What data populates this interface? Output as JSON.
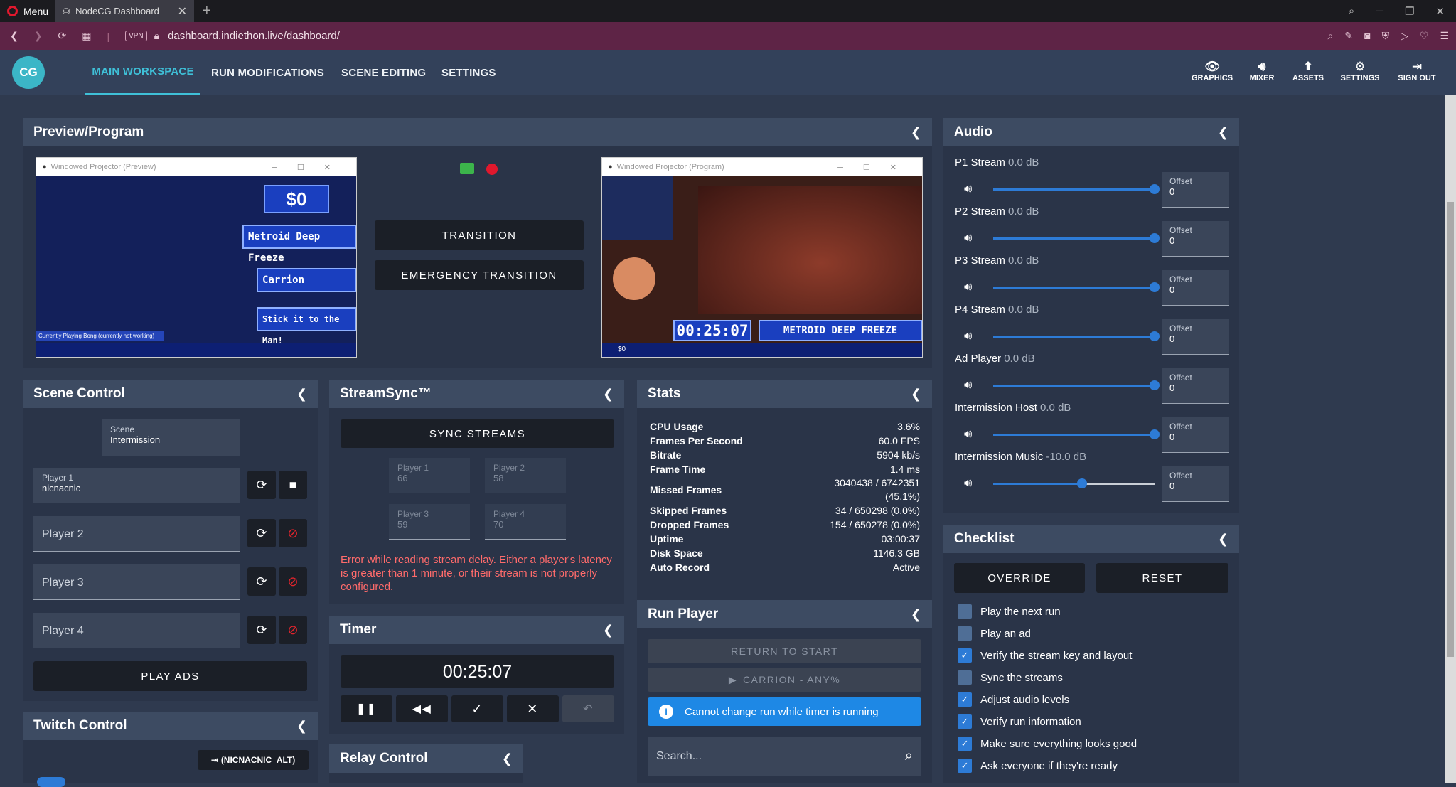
{
  "browser": {
    "menu_label": "Menu",
    "tab_title": "NodeCG Dashboard",
    "url": "dashboard.indiethon.live/dashboard/",
    "vpn": "VPN"
  },
  "app": {
    "logo_text": "CG",
    "nav_tabs": [
      "MAIN WORKSPACE",
      "RUN MODIFICATIONS",
      "SCENE EDITING",
      "SETTINGS"
    ],
    "right_icons": [
      "GRAPHICS",
      "MIXER",
      "ASSETS",
      "SETTINGS",
      "SIGN OUT"
    ]
  },
  "preview": {
    "title": "Preview/Program",
    "preview_window_title": "Windowed Projector (Preview)",
    "program_window_title": "Windowed Projector (Program)",
    "preview_money": "$0",
    "preview_games": [
      "Metroid Deep Freeze",
      "Carrion",
      "Stick it to the Man!"
    ],
    "preview_ticker": "Currently Playing Bong (currently not working)",
    "program_timer": "00:25:07",
    "program_game": "METROID DEEP FREEZE",
    "program_money": "$0",
    "transition_label": "TRANSITION",
    "emergency_label": "EMERGENCY TRANSITION"
  },
  "scene_control": {
    "title": "Scene Control",
    "scene_label": "Scene",
    "scene_value": "Intermission",
    "players": [
      {
        "label": "Player 1",
        "value": "nicnacnic"
      },
      {
        "label": "Player 2",
        "value": ""
      },
      {
        "label": "Player 3",
        "value": ""
      },
      {
        "label": "Player 4",
        "value": ""
      }
    ],
    "play_ads": "PLAY ADS"
  },
  "streamsync": {
    "title": "StreamSync™",
    "sync_label": "SYNC STREAMS",
    "players": [
      {
        "label": "Player 1",
        "value": "66"
      },
      {
        "label": "Player 2",
        "value": "58"
      },
      {
        "label": "Player 3",
        "value": "59"
      },
      {
        "label": "Player 4",
        "value": "70"
      }
    ],
    "error": "Error while reading stream delay. Either a player's latency is greater than 1 minute, or their stream is not properly configured."
  },
  "stats": {
    "title": "Stats",
    "rows": [
      {
        "k": "CPU Usage",
        "v": "3.6%"
      },
      {
        "k": "Frames Per Second",
        "v": "60.0 FPS"
      },
      {
        "k": "Bitrate",
        "v": "5904 kb/s"
      },
      {
        "k": "Frame Time",
        "v": "1.4 ms"
      },
      {
        "k": "Missed Frames",
        "v": "3040438 / 6742351 (45.1%)"
      },
      {
        "k": "Skipped Frames",
        "v": "34 / 650298 (0.0%)"
      },
      {
        "k": "Dropped Frames",
        "v": "154 / 650278 (0.0%)"
      },
      {
        "k": "Uptime",
        "v": "03:00:37"
      },
      {
        "k": "Disk Space",
        "v": "1146.3 GB"
      },
      {
        "k": "Auto Record",
        "v": "Active"
      }
    ]
  },
  "timer": {
    "title": "Timer",
    "time": "00:25:07"
  },
  "run_player": {
    "title": "Run Player",
    "return_label": "RETURN TO START",
    "next_run": "CARRION - ANY%",
    "info": "Cannot change run while timer is running",
    "search_placeholder": "Search..."
  },
  "twitch": {
    "title": "Twitch Control",
    "account": "(NICNACNIC_ALT)"
  },
  "relay": {
    "title": "Relay Control"
  },
  "audio": {
    "title": "Audio",
    "offset_label": "Offset",
    "channels": [
      {
        "name": "P1 Stream",
        "db": "0.0 dB",
        "level": 1.0,
        "offset": "0"
      },
      {
        "name": "P2 Stream",
        "db": "0.0 dB",
        "level": 1.0,
        "offset": "0"
      },
      {
        "name": "P3 Stream",
        "db": "0.0 dB",
        "level": 1.0,
        "offset": "0"
      },
      {
        "name": "P4 Stream",
        "db": "0.0 dB",
        "level": 1.0,
        "offset": "0"
      },
      {
        "name": "Ad Player",
        "db": "0.0 dB",
        "level": 1.0,
        "offset": "0"
      },
      {
        "name": "Intermission Host",
        "db": "0.0 dB",
        "level": 1.0,
        "offset": "0"
      },
      {
        "name": "Intermission Music",
        "db": "-10.0 dB",
        "level": 0.55,
        "offset": "0"
      }
    ]
  },
  "checklist": {
    "title": "Checklist",
    "override": "OVERRIDE",
    "reset": "RESET",
    "items": [
      {
        "label": "Play the next run",
        "checked": false
      },
      {
        "label": "Play an ad",
        "checked": false
      },
      {
        "label": "Verify the stream key and layout",
        "checked": true
      },
      {
        "label": "Sync the streams",
        "checked": false
      },
      {
        "label": "Adjust audio levels",
        "checked": true
      },
      {
        "label": "Verify run information",
        "checked": true
      },
      {
        "label": "Make sure everything looks good",
        "checked": true
      },
      {
        "label": "Ask everyone if they're ready",
        "checked": true
      }
    ]
  },
  "colors": {
    "accent": "#3fc0d8",
    "slider": "#2d7bd6",
    "error": "#ff6b6b",
    "panel_header": "#3d4b62"
  }
}
